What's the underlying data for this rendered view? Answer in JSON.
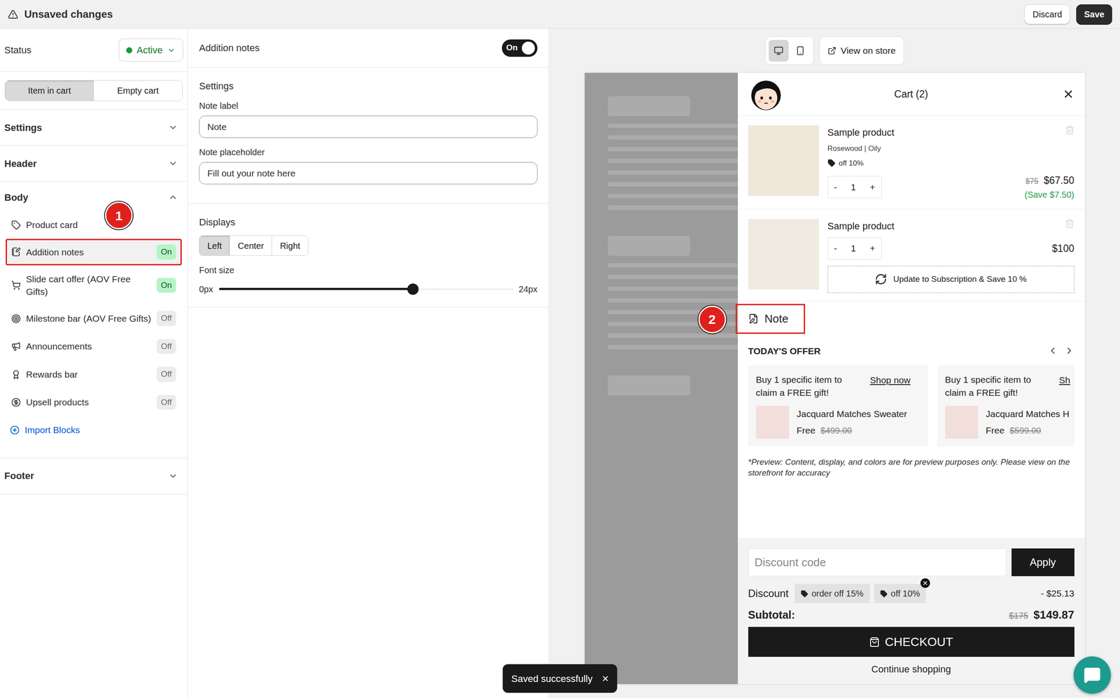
{
  "topbar": {
    "title": "Unsaved changes",
    "discard": "Discard",
    "save": "Save"
  },
  "status": {
    "label": "Status",
    "value": "Active"
  },
  "modes": [
    {
      "label": "Item in cart",
      "selected": true
    },
    {
      "label": "Empty cart",
      "selected": false
    }
  ],
  "sections": [
    {
      "label": "Settings",
      "expanded": false,
      "items": []
    },
    {
      "label": "Header",
      "expanded": false,
      "items": []
    },
    {
      "label": "Body",
      "expanded": true,
      "link": "Import Blocks",
      "items": [
        {
          "label": "Product card",
          "selected": false
        },
        {
          "label": "Addition notes",
          "selected": true,
          "badge": "On",
          "on": true
        },
        {
          "label": "Slide cart offer (AOV Free Gifts)",
          "selected": false,
          "badge": "On",
          "on": true
        },
        {
          "label": "Milestone bar (AOV Free Gifts)",
          "selected": false,
          "badge": "Off",
          "on": false
        },
        {
          "label": "Announcements",
          "selected": false,
          "badge": "Off",
          "on": false
        },
        {
          "label": "Rewards bar",
          "selected": false,
          "badge": "Off",
          "on": false
        },
        {
          "label": "Upsell products",
          "selected": false,
          "badge": "Off",
          "on": false
        }
      ]
    },
    {
      "label": "Footer",
      "expanded": false,
      "items": []
    }
  ],
  "editor": {
    "title": "Addition notes",
    "toggle": {
      "label": "On",
      "on": true
    },
    "settings_title": "Settings",
    "fields": [
      {
        "label": "Note label",
        "value": "Note"
      },
      {
        "label": "Note placeholder",
        "value": "Fill out your note here"
      }
    ],
    "displays_title": "Displays",
    "alignments": [
      {
        "label": "Left",
        "selected": true
      },
      {
        "label": "Center",
        "selected": false
      },
      {
        "label": "Right",
        "selected": false
      }
    ],
    "font_size": {
      "label": "Font size",
      "min": "0px",
      "max": "24px",
      "level": 0.66
    }
  },
  "preview": {
    "devices": [
      {
        "selected": true
      },
      {
        "selected": false
      }
    ],
    "view": "View on store",
    "cart_title": "Cart (2)",
    "items": [
      {
        "name": "Sample product",
        "variant": "Rosewood | Oily",
        "tag": "off 10%",
        "minus": "-",
        "qty": "1",
        "plus": "+",
        "old_price": "$75",
        "price": "$67.50",
        "save": "(Save $7.50)"
      },
      {
        "name": "Sample product",
        "minus": "-",
        "qty": "1",
        "plus": "+",
        "price": "$100",
        "upgrade": "Update to Subscription & Save 10 %"
      }
    ],
    "note": "Note",
    "offer_title": "TODAY'S OFFER",
    "cards": [
      {
        "text": "Buy 1 specific item to claim a FREE gift!",
        "link": "Shop now",
        "product": "Jacquard Matches Sweater",
        "price": "Free",
        "old_price": "$499.00"
      },
      {
        "text": "Buy 1 specific item to claim a FREE gift!",
        "link": "Sh",
        "product": "Jacquard Matches H",
        "price": "Free",
        "old_price": "$599.00"
      }
    ],
    "disclaimer": "*Preview: Content, display, and colors are for preview purposes only. Please view on the storefront for accuracy",
    "footer": {
      "discount_placeholder": "Discount code",
      "apply": "Apply",
      "discount_label": "Discount",
      "codes": [
        {
          "label": "order off 15%",
          "removable": false
        },
        {
          "label": "off 10%",
          "removable": true
        }
      ],
      "discount_amount": "- $25.13",
      "subtotal_label": "Subtotal:",
      "subtotal_old": "$175",
      "subtotal": "$149.87",
      "checkout": "CHECKOUT",
      "continue": "Continue shopping"
    }
  },
  "toast": {
    "text": "Saved successfully",
    "close": "×"
  },
  "annotations": [
    "1",
    "2"
  ]
}
